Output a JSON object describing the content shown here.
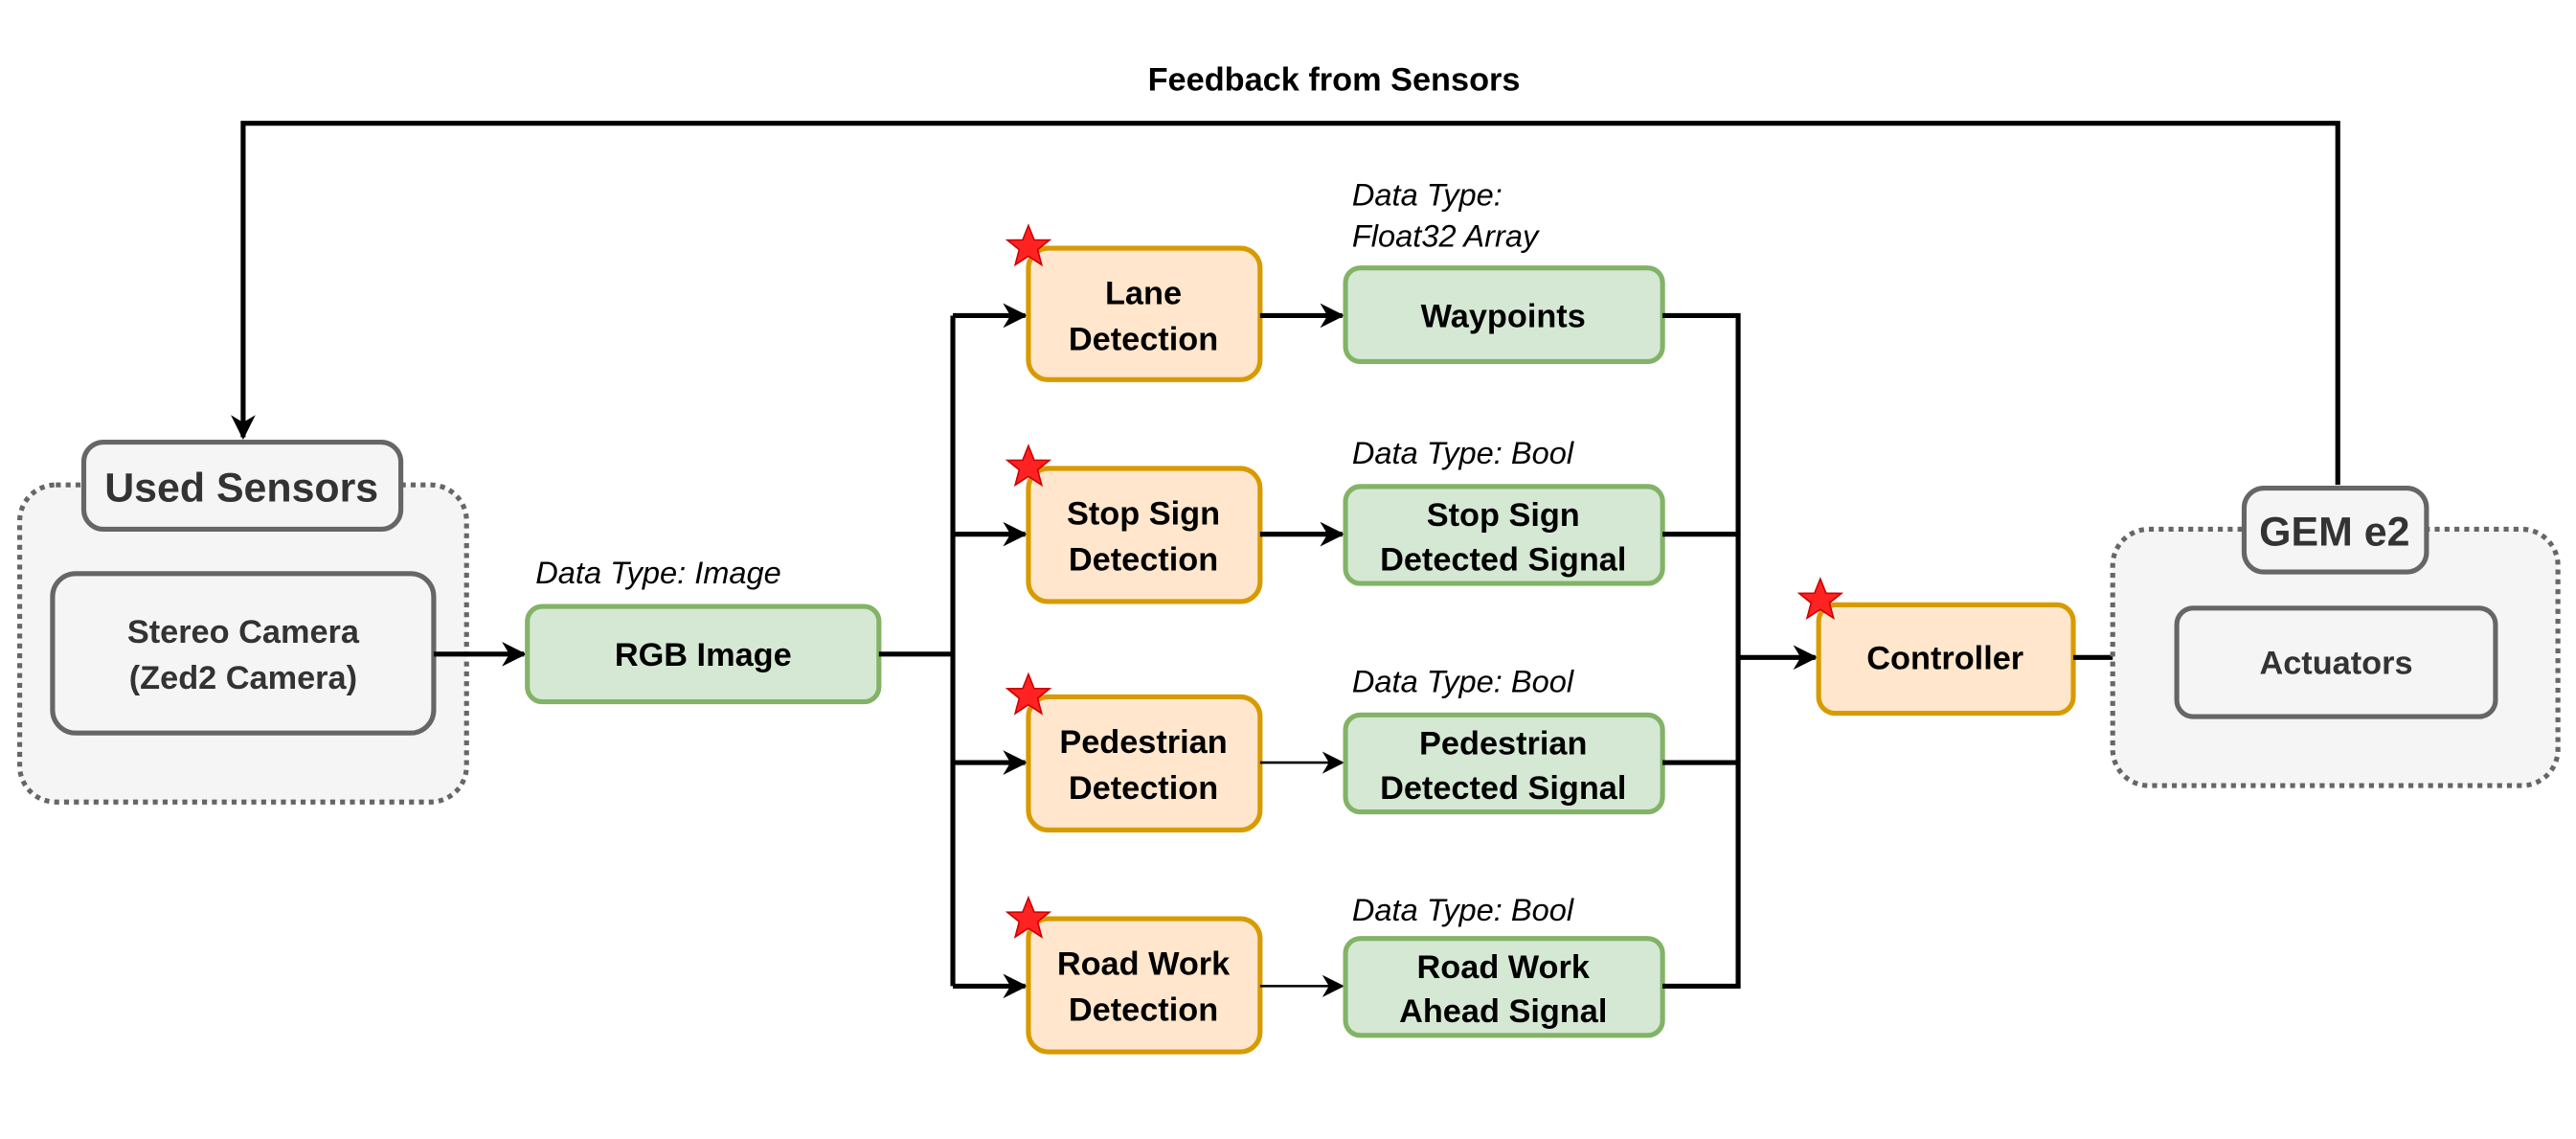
{
  "title": "Feedback from Sensors",
  "colors": {
    "process_fill": "#ffe6cc",
    "process_stroke": "#d79b00",
    "data_fill": "#d5e8d4",
    "data_stroke": "#82b366",
    "hw_fill": "#f5f5f5",
    "hw_stroke": "#666666",
    "star": "#ff0000"
  },
  "sensors": {
    "group_label": "Used Sensors",
    "camera_line1": "Stereo Camera",
    "camera_line2": "(Zed2 Camera)"
  },
  "rgb": {
    "type_label": "Data Type: Image",
    "label": "RGB Image"
  },
  "lane": {
    "line1": "Lane",
    "line2": "Detection",
    "type_line1": "Data Type:",
    "type_line2": "Float32 Array",
    "output": "Waypoints"
  },
  "stop": {
    "line1": "Stop Sign",
    "line2": "Detection",
    "type_label": "Data Type: Bool",
    "out1": "Stop Sign",
    "out2": "Detected Signal"
  },
  "ped": {
    "line1": "Pedestrian",
    "line2": "Detection",
    "type_label": "Data Type: Bool",
    "out1": "Pedestrian",
    "out2": "Detected Signal"
  },
  "road": {
    "line1": "Road Work",
    "line2": "Detection",
    "type_label": "Data Type: Bool",
    "out1": "Road Work",
    "out2": "Ahead Signal"
  },
  "controller": {
    "label": "Controller"
  },
  "vehicle": {
    "group_label": "GEM e2",
    "actuators": "Actuators"
  },
  "icons": {
    "new_component_marker": "red-star-icon"
  }
}
